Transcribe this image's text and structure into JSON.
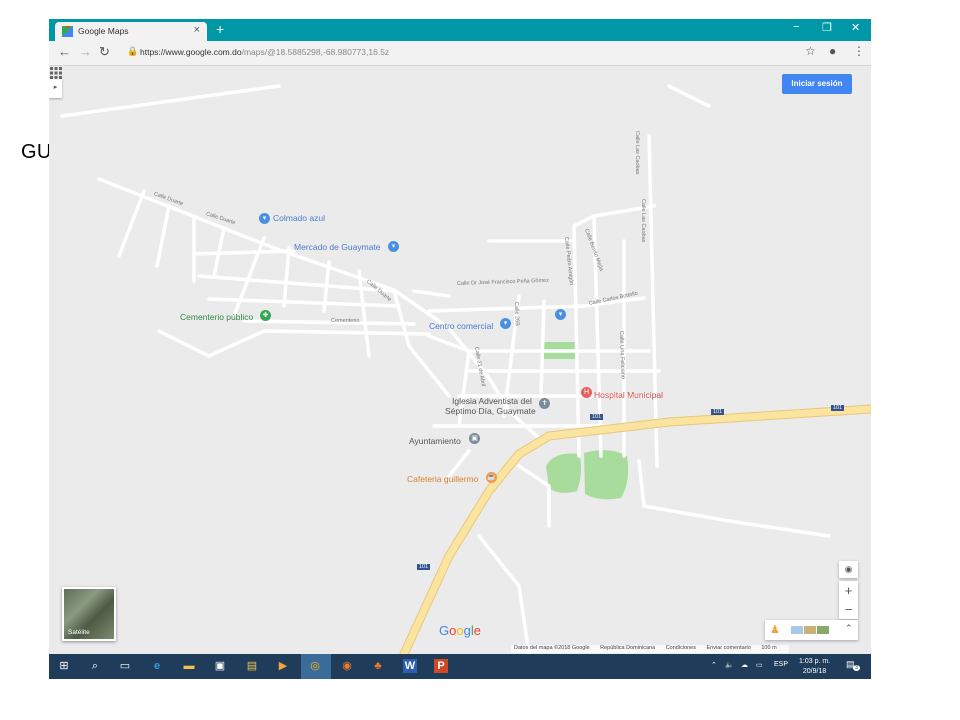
{
  "slide_label": "GUAYMATE",
  "browser": {
    "tab_title": "Google Maps",
    "new_tab": "+",
    "url_host": "https://www.google.com.do",
    "url_path": "/maps/@18.5885298,-68.980773,16.5z"
  },
  "map": {
    "signin_label": "Iniciar sesión",
    "satellite_label": "Satélite",
    "google_logo": "Google",
    "places": [
      {
        "name": "Colmado azul"
      },
      {
        "name": "Mercado de Guaymate"
      },
      {
        "name": "Cementerio público"
      },
      {
        "name": "Centro comercial"
      },
      {
        "name": "Hospital Municipal"
      },
      {
        "name": "Iglesia Adventista del"
      },
      {
        "name": "Séptimo Día, Guaymate"
      },
      {
        "name": "Ayuntamiento"
      },
      {
        "name": "Cafeteria guillermo"
      }
    ],
    "streets": [
      "Calle Duarte",
      "Calle Duarte",
      "Calle Duarte",
      "Cementerio",
      "Calle Dr José Francisco Peña Gómez",
      "Calle 26B",
      "Calle 21 de Abril",
      "Calle Carlos Bottello",
      "Calle Lina Feliciano",
      "Calle Pedro Amigón",
      "Calle Benito Mejía",
      "Calle Las Caobas",
      "Calle Las Caobas"
    ],
    "highway_shields": [
      "101",
      "101",
      "101",
      "101"
    ],
    "footer": {
      "data": "Datos del mapa ©2018 Google",
      "country": "República Dominicana",
      "terms": "Condiciones",
      "feedback": "Enviar comentario",
      "scale": "100 m"
    },
    "zoom_in": "+",
    "zoom_out": "−"
  },
  "taskbar": {
    "language": "ESP",
    "time": "1:03 p. m.",
    "date": "20/9/18",
    "notifications": "3"
  },
  "colors": {
    "titlebar": "#0097a7",
    "map_bg": "#ebebeb",
    "road": "#ffffff",
    "highway": "#f8d98a",
    "park": "#a8dc9c",
    "poi_blue": "#4a90e2",
    "poi_green": "#34a853",
    "hospital": "#e36060",
    "food": "#f2994a",
    "signin": "#4285f4",
    "taskbar": "#1f3d5a"
  }
}
